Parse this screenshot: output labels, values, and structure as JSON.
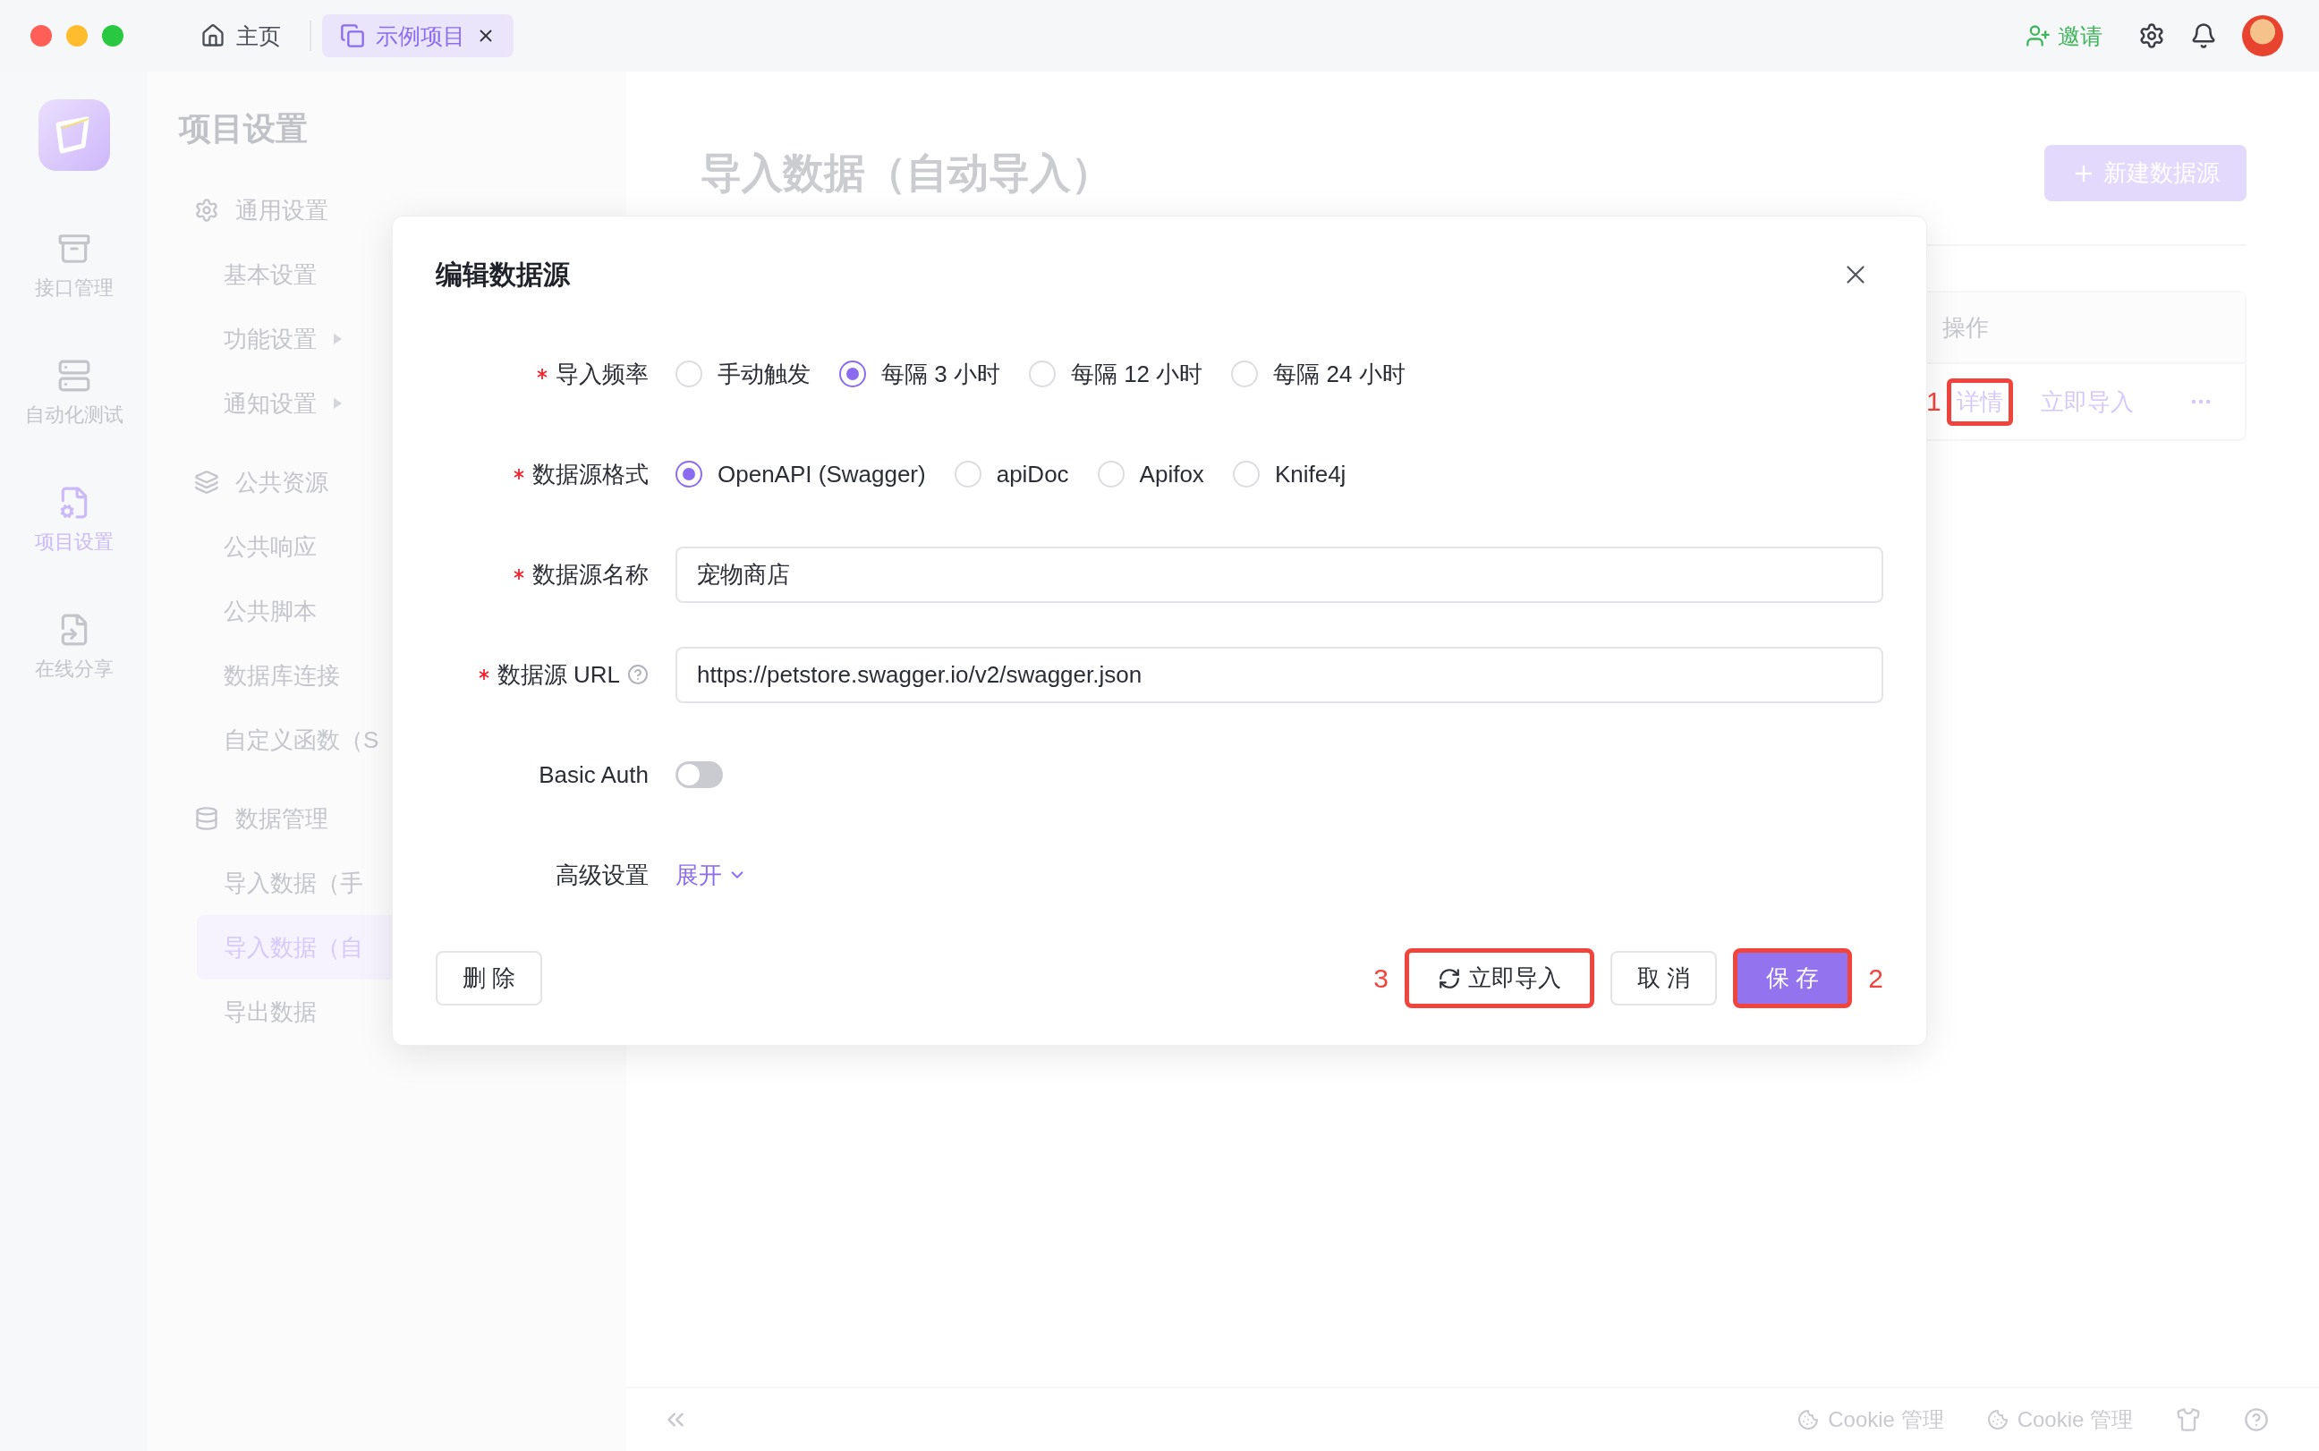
{
  "tabs": [
    {
      "label": "主页",
      "selected": false,
      "closable": false
    },
    {
      "label": "示例项目",
      "selected": true,
      "closable": true
    }
  ],
  "toolbar": {
    "invite": "邀请"
  },
  "rail": [
    {
      "label": "接口管理",
      "selected": false
    },
    {
      "label": "自动化测试",
      "selected": false
    },
    {
      "label": "项目设置",
      "selected": true
    },
    {
      "label": "在线分享",
      "selected": false
    }
  ],
  "nav": {
    "title": "项目设置",
    "groups": [
      {
        "label": "通用设置",
        "children": [
          {
            "label": "基本设置",
            "selected": false,
            "submenu": false
          },
          {
            "label": "功能设置",
            "selected": false,
            "submenu": true
          },
          {
            "label": "通知设置",
            "selected": false,
            "submenu": true
          }
        ]
      },
      {
        "label": "公共资源",
        "children": [
          {
            "label": "公共响应",
            "selected": false,
            "submenu": false
          },
          {
            "label": "公共脚本",
            "selected": false,
            "submenu": false
          },
          {
            "label": "数据库连接",
            "selected": false,
            "submenu": false
          },
          {
            "label": "自定义函数（S",
            "selected": false,
            "submenu": false
          }
        ]
      },
      {
        "label": "数据管理",
        "children": [
          {
            "label": "导入数据（手",
            "selected": false,
            "submenu": false
          },
          {
            "label": "导入数据（自",
            "selected": true,
            "submenu": false
          },
          {
            "label": "导出数据",
            "selected": false,
            "submenu": false
          }
        ]
      }
    ]
  },
  "page": {
    "title": "导入数据（自动导入）",
    "new_button": "新建数据源",
    "table": {
      "header": "操作",
      "actions": [
        {
          "label": "详情",
          "highlighted": true,
          "callout": "1"
        },
        {
          "label": "立即导入",
          "highlighted": false
        }
      ]
    }
  },
  "dialog": {
    "title": "编辑数据源",
    "fields": [
      {
        "kind": "radio",
        "label": "导入频率",
        "required": true,
        "options": [
          {
            "label": "手动触发",
            "selected": false
          },
          {
            "label": "每隔 3 小时",
            "selected": true
          },
          {
            "label": "每隔 12 小时",
            "selected": false
          },
          {
            "label": "每隔 24 小时",
            "selected": false
          }
        ]
      },
      {
        "kind": "radio",
        "label": "数据源格式",
        "required": true,
        "options": [
          {
            "label": "OpenAPI (Swagger)",
            "selected": true
          },
          {
            "label": "apiDoc",
            "selected": false
          },
          {
            "label": "Apifox",
            "selected": false
          },
          {
            "label": "Knife4j",
            "selected": false
          }
        ]
      },
      {
        "kind": "input",
        "label": "数据源名称",
        "required": true,
        "value": "宠物商店"
      },
      {
        "kind": "input",
        "label": "数据源 URL",
        "required": true,
        "help": true,
        "value": "https://petstore.swagger.io/v2/swagger.json"
      },
      {
        "kind": "toggle",
        "label": "Basic Auth",
        "required": false,
        "on": false
      },
      {
        "kind": "expand",
        "label": "高级设置",
        "required": false,
        "link": "展开",
        "expanded": false
      }
    ],
    "delete_button": "删 除",
    "actions": [
      {
        "label": "立即导入",
        "kind": "refresh",
        "highlighted": true,
        "callout": "3"
      },
      {
        "label": "取 消",
        "kind": "default",
        "highlighted": false
      },
      {
        "label": "保 存",
        "kind": "primary",
        "highlighted": true,
        "callout": "2"
      }
    ]
  },
  "footer": {
    "items": [
      "Cookie 管理",
      "Cookie 管理"
    ]
  }
}
